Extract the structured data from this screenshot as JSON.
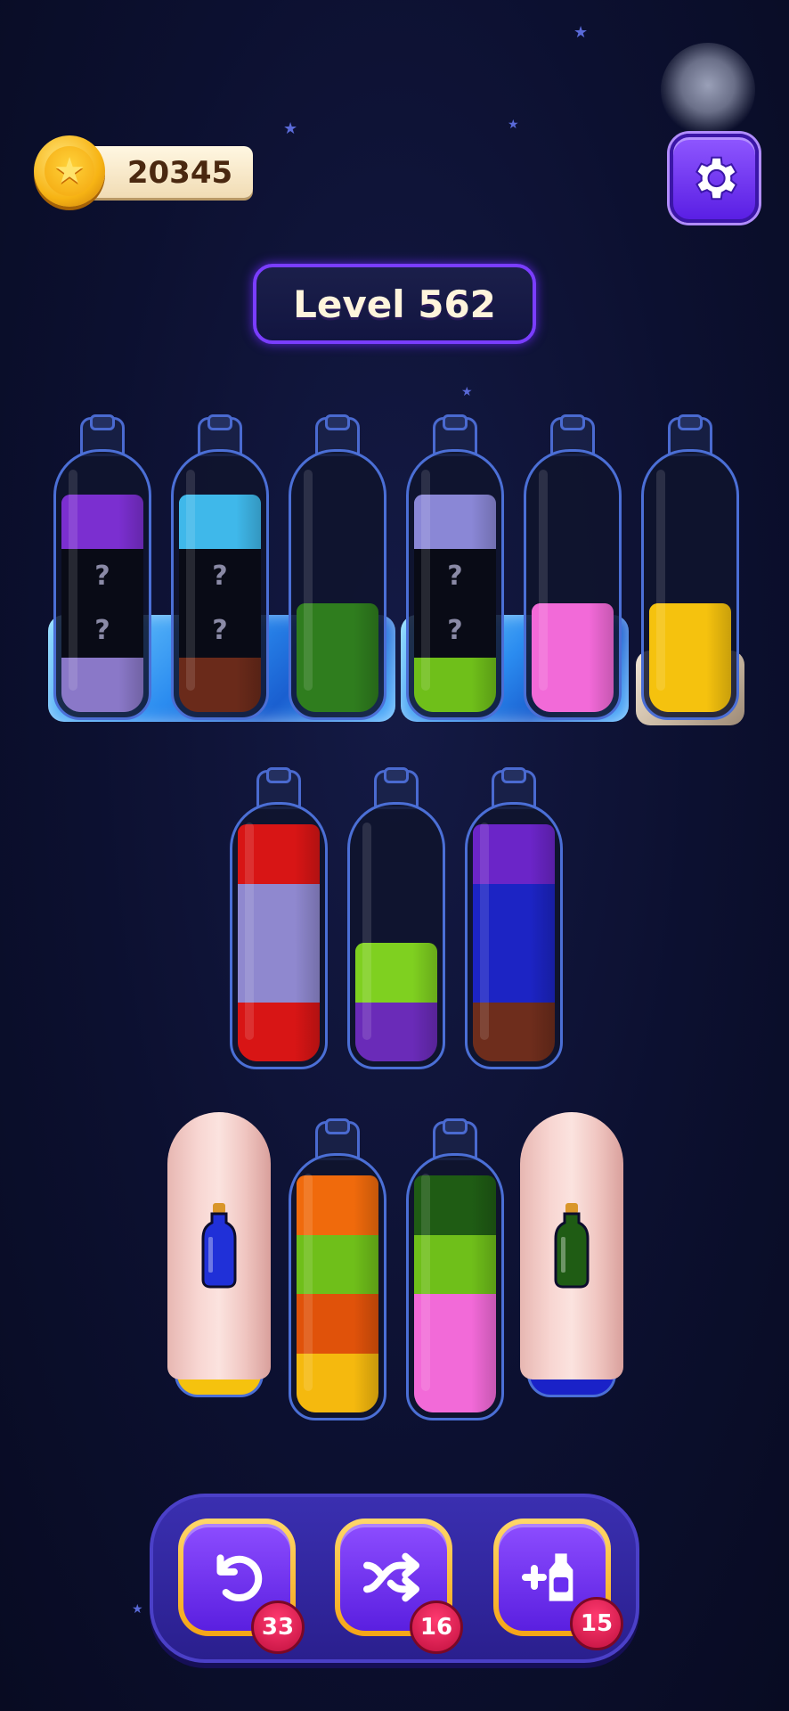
{
  "coins": {
    "value": "20345"
  },
  "level": {
    "label": "Level 562"
  },
  "icons": {
    "coin": "star-coin-icon",
    "settings": "gear-icon",
    "undo": "undo-icon",
    "shuffle": "shuffle-icon",
    "add_bottle": "add-bottle-icon"
  },
  "hidden_marker": "?",
  "bottles_row1": [
    {
      "layers": [
        "#7b2fd0",
        "hidden",
        "hidden",
        "#8a78c8"
      ],
      "base": "ice"
    },
    {
      "layers": [
        "#3fb8ea",
        "hidden",
        "hidden",
        "#6a2a1a"
      ],
      "base": "ice"
    },
    {
      "layers": [
        "#2f7d1e",
        "#2f7d1e"
      ],
      "base": "ice"
    },
    {
      "layers": [
        "#8a87d6",
        "hidden",
        "hidden",
        "#6fbf1a"
      ],
      "base": "ice"
    },
    {
      "layers": [
        "#f26ad8",
        "#f26ad8"
      ],
      "base": "ice"
    },
    {
      "layers": [
        "#f5c20e",
        "#f5c20e"
      ],
      "base": "rock"
    }
  ],
  "bottles_row2": [
    {
      "layers": [
        "#d81515",
        "#8f88cf",
        "#8f88cf",
        "#d81515"
      ]
    },
    {
      "layers": [
        "#7fd020",
        "#6a2bb8"
      ]
    },
    {
      "layers": [
        "#6b25c8",
        "#1c24c4",
        "#1c24c4",
        "#6e2d1c"
      ]
    }
  ],
  "bottles_row3": [
    {
      "covered": true,
      "hint_color": "#2030d8",
      "base_color": "#f5c20e"
    },
    {
      "covered": false,
      "layers": [
        "#f06a0c",
        "#6fbf1a",
        "#e0520a",
        "#f5b90e"
      ]
    },
    {
      "covered": false,
      "layers": [
        "#1f5c14",
        "#6fbf1a",
        "#f26ad8",
        "#f26ad8"
      ]
    },
    {
      "covered": true,
      "hint_color": "#1f5c14",
      "base_color": "#1a22c8"
    }
  ],
  "toolbar": {
    "undo_count": "33",
    "shuffle_count": "16",
    "add_bottle_count": "15"
  }
}
